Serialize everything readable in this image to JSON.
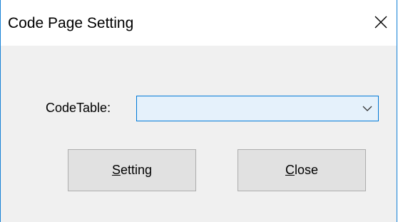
{
  "window": {
    "title": "Code Page Setting",
    "close_glyph": "×"
  },
  "form": {
    "codetable_label": "CodeTable:",
    "codetable_value": "",
    "dropdown_icon": "chevron-down-icon"
  },
  "buttons": {
    "setting": {
      "mnemonic": "S",
      "rest": "etting"
    },
    "close": {
      "mnemonic": "C",
      "rest": "lose"
    }
  },
  "colors": {
    "window_border": "#1883d7",
    "client_background": "#f0f0f0",
    "combo_background": "#e5f1fb",
    "combo_border": "#0078d7",
    "button_background": "#e1e1e1",
    "button_border": "#adadad"
  }
}
